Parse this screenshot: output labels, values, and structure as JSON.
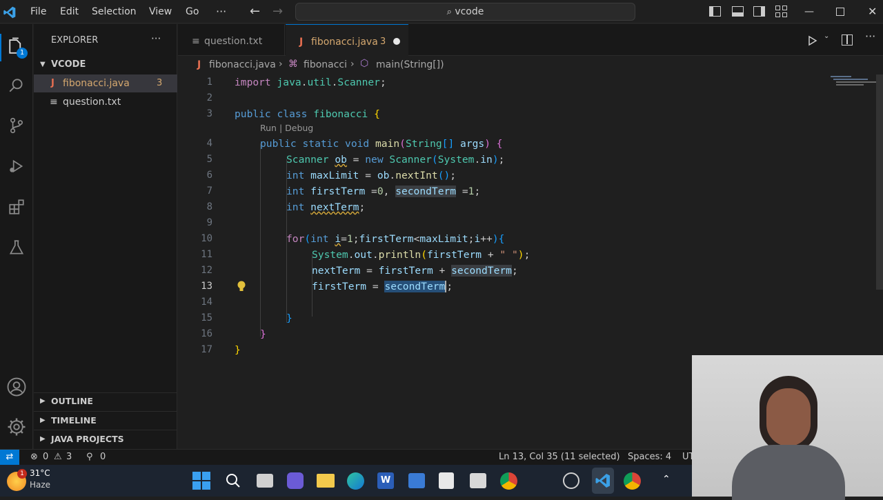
{
  "titlebar": {
    "menus": [
      "File",
      "Edit",
      "Selection",
      "View",
      "Go"
    ],
    "more": "···",
    "search_text": "vcode"
  },
  "sidebar": {
    "title": "EXPLORER",
    "more": "···",
    "folder": "VCODE",
    "files": [
      {
        "name": "fibonacci.java",
        "badge": "3",
        "active": true
      },
      {
        "name": "question.txt",
        "badge": "",
        "active": false
      }
    ],
    "sections": [
      "OUTLINE",
      "TIMELINE",
      "JAVA PROJECTS"
    ]
  },
  "tabs": [
    {
      "label": "question.txt",
      "badge": "",
      "active": false
    },
    {
      "label": "fibonacci.java",
      "badge": "3",
      "active": true
    }
  ],
  "breadcrumbs": [
    "fibonacci.java",
    "fibonacci",
    "main(String[])"
  ],
  "editor": {
    "codelens": "Run | Debug",
    "line_numbers": [
      "1",
      "2",
      "3",
      "4",
      "5",
      "6",
      "7",
      "8",
      "9",
      "10",
      "11",
      "12",
      "13",
      "14",
      "15",
      "16",
      "17"
    ],
    "current_line": "13"
  },
  "statusbar": {
    "errors": "0",
    "warnings": "3",
    "ports": "0",
    "position": "Ln 13, Col 35 (11 selected)",
    "spaces": "Spaces: 4",
    "encoding": "UT"
  },
  "taskbar": {
    "weather_temp": "31°C",
    "weather_desc": "Haze",
    "notification_count": "1"
  },
  "colors": {
    "accent": "#0078d4",
    "selection": "#264f78"
  }
}
